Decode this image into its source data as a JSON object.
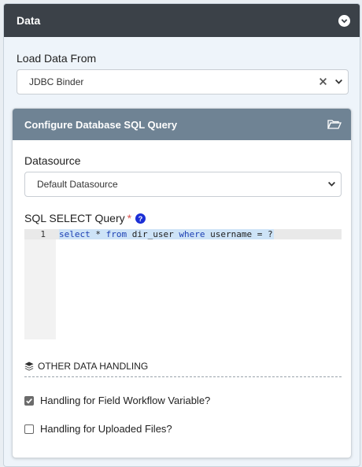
{
  "panel": {
    "title": "Data"
  },
  "load_data": {
    "label": "Load Data From",
    "selected": "JDBC Binder"
  },
  "sub_panel": {
    "title": "Configure Database SQL Query",
    "datasource_label": "Datasource",
    "datasource_selected": "Default Datasource",
    "sql_label": "SQL SELECT Query",
    "required_mark": "*",
    "editor": {
      "line_number": "1",
      "tokens": [
        "select",
        " * ",
        "from",
        " dir_user ",
        "where",
        " username = ?"
      ]
    },
    "other_section_title": "OTHER DATA HANDLING",
    "options": [
      {
        "label": "Handling for Field Workflow Variable?",
        "checked": true
      },
      {
        "label": "Handling for Uploaded Files?",
        "checked": false
      }
    ]
  },
  "colors": {
    "header_bg": "#3b4148",
    "subheader_bg": "#6f8394",
    "help_icon": "#1b2fd6",
    "required": "#d9534f"
  },
  "icons": [
    "chevron-down-circle-icon",
    "clear-x-icon",
    "chevron-down-icon",
    "folder-open-icon",
    "help-circle-icon",
    "layers-icon",
    "checkbox-checked-icon"
  ]
}
